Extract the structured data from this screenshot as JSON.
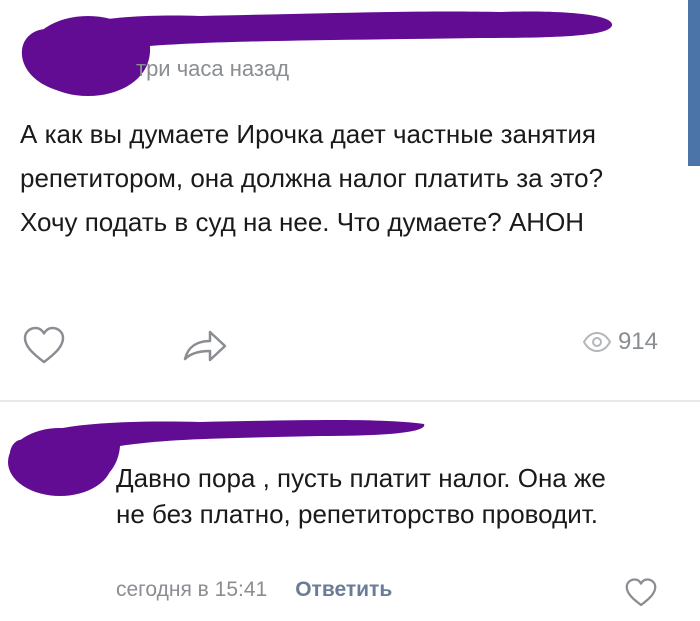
{
  "post": {
    "time": "три часа назад",
    "text": "А как вы думаете Ирочка дает частные занятия репетитором, она должна налог платить за это? Хочу подать в суд на нее. Что думаете? АНОН",
    "views": "914",
    "icons": {
      "like": "heart-outline-icon",
      "share": "share-arrow-icon",
      "views": "eye-icon"
    }
  },
  "comment": {
    "text": "Давно пора , пусть платит налог. Она же не без платно, репетиторство проводит.",
    "time": "сегодня в 15:41",
    "reply_label": "Ответить",
    "icons": {
      "like": "heart-outline-icon"
    }
  },
  "colors": {
    "redaction": "#620c94",
    "muted_text": "#8a8d91",
    "reply_link": "#6b7d96",
    "side_strip": "#4b74a8"
  }
}
